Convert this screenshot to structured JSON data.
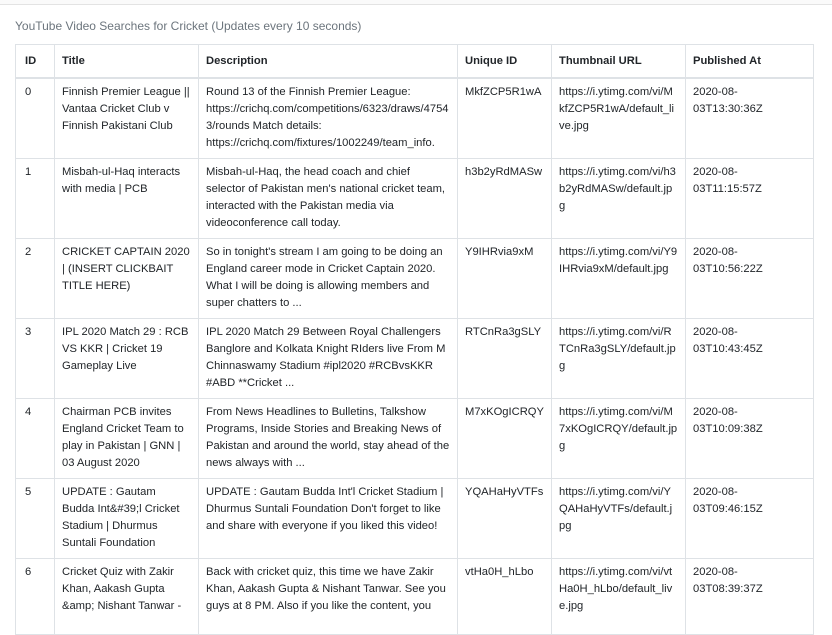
{
  "caption": "YouTube Video Searches for Cricket (Updates every 10 seconds)",
  "columns": [
    "ID",
    "Title",
    "Description",
    "Unique ID",
    "Thumbnail URL",
    "Published At"
  ],
  "rows": [
    {
      "id": "0",
      "title": "Finnish Premier League || Vantaa Cricket Club v Finnish Pakistani Club",
      "description": "Round 13 of the Finnish Premier League: https://crichq.com/competitions/6323/draws/47543/rounds Match details: https://crichq.com/fixtures/1002249/team_info.",
      "unique_id": "MkfZCP5R1wA",
      "thumbnail": "https://i.ytimg.com/vi/MkfZCP5R1wA/default_live.jpg",
      "published": "2020-08-03T13:30:36Z"
    },
    {
      "id": "1",
      "title": "Misbah-ul-Haq interacts with media | PCB",
      "description": "Misbah-ul-Haq, the head coach and chief selector of Pakistan men's national cricket team, interacted with the Pakistan media via videoconference call today.",
      "unique_id": "h3b2yRdMASw",
      "thumbnail": "https://i.ytimg.com/vi/h3b2yRdMASw/default.jpg",
      "published": "2020-08-03T11:15:57Z"
    },
    {
      "id": "2",
      "title": "CRICKET CAPTAIN 2020 | (INSERT CLICKBAIT TITLE HERE)",
      "description": "So in tonight's stream I am going to be doing an England career mode in Cricket Captain 2020. What I will be doing is allowing members and super chatters to ...",
      "unique_id": "Y9IHRvia9xM",
      "thumbnail": "https://i.ytimg.com/vi/Y9IHRvia9xM/default.jpg",
      "published": "2020-08-03T10:56:22Z"
    },
    {
      "id": "3",
      "title": "IPL 2020 Match 29 : RCB VS KKR | Cricket 19 Gameplay Live",
      "description": "IPL 2020 Match 29 Between Royal Challengers Banglore and Kolkata Knight RIders live From M Chinnaswamy Stadium #ipl2020 #RCBvsKKR #ABD **Cricket ...",
      "unique_id": "RTCnRa3gSLY",
      "thumbnail": "https://i.ytimg.com/vi/RTCnRa3gSLY/default.jpg",
      "published": "2020-08-03T10:43:45Z"
    },
    {
      "id": "4",
      "title": "Chairman PCB invites England Cricket Team to play in Pakistan | GNN | 03 August 2020",
      "description": "From News Headlines to Bulletins, Talkshow Programs, Inside Stories and Breaking News of Pakistan and around the world, stay ahead of the news always with ...",
      "unique_id": "M7xKOgICRQY",
      "thumbnail": "https://i.ytimg.com/vi/M7xKOgICRQY/default.jpg",
      "published": "2020-08-03T10:09:38Z"
    },
    {
      "id": "5",
      "title": "UPDATE : Gautam Budda Int&#39;l Cricket Stadium | Dhurmus Suntali Foundation",
      "description": "UPDATE : Gautam Budda Int'l Cricket Stadium | Dhurmus Suntali Foundation Don't forget to like and share with everyone if you liked this video!",
      "unique_id": "YQAHaHyVTFs",
      "thumbnail": "https://i.ytimg.com/vi/YQAHaHyVTFs/default.jpg",
      "published": "2020-08-03T09:46:15Z"
    },
    {
      "id": "6",
      "title": "Cricket Quiz with Zakir Khan, Aakash Gupta &amp; Nishant Tanwar -",
      "description": "Back with cricket quiz, this time we have Zakir Khan, Aakash Gupta & Nishant Tanwar. See you guys at 8 PM. Also if you like the content, you",
      "unique_id": "vtHa0H_hLbo",
      "thumbnail": "https://i.ytimg.com/vi/vtHa0H_hLbo/default_live.jpg",
      "published": "2020-08-03T08:39:37Z"
    }
  ]
}
